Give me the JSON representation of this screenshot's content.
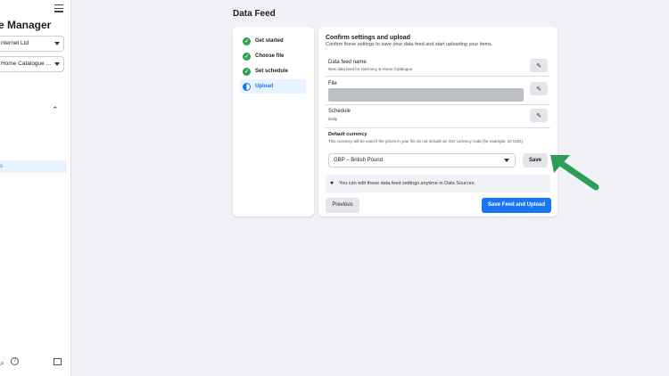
{
  "sidebar": {
    "title": "e Manager",
    "business_select": "nternet Ltd",
    "catalogue_select": "Home Catalogue ...",
    "active_item": "s"
  },
  "main": {
    "page_title": "Data Feed",
    "steps": [
      {
        "label": "Get started",
        "state": "done"
      },
      {
        "label": "Choose file",
        "state": "done"
      },
      {
        "label": "Set schedule",
        "state": "done"
      },
      {
        "label": "Upload",
        "state": "current"
      }
    ],
    "panel": {
      "heading": "Confirm settings and upload",
      "subheading": "Confirm these settings to save your data feed and start uploading your items.",
      "feed_name_label": "Data feed name",
      "feed_name_value": "New data feed for Harmony & Home Catalogue",
      "file_label": "File",
      "schedule_label": "Schedule",
      "schedule_value": "Daily",
      "currency_label": "Default currency",
      "currency_desc": "This currency will be used if the prices in your file do not include an ISO currency code (for example: 10 USD).",
      "currency_value": "GBP – British Pound",
      "save_label": "Save",
      "tip_text": "You can edit these data feed settings anytime in Data Sources.",
      "previous_label": "Previous",
      "primary_label": "Save Feed and Upload"
    }
  },
  "colors": {
    "accent": "#1877f2",
    "success": "#31a24c",
    "arrow": "#2e9e57"
  },
  "icons": [
    "menu-icon",
    "check-icon",
    "half-circle-icon",
    "pencil-icon",
    "lightbulb-icon",
    "help-icon",
    "arrow-annotation"
  ]
}
